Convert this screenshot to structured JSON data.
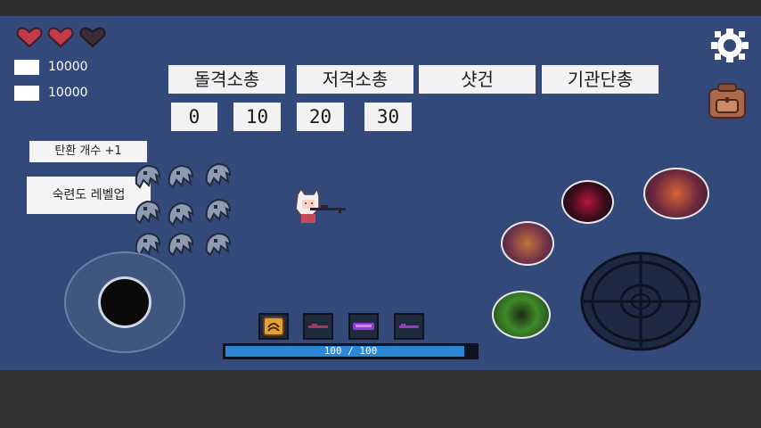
{
  "hud": {
    "hearts": [
      {
        "state": "full",
        "color": "#c23b4a"
      },
      {
        "state": "full",
        "color": "#c23b4a"
      },
      {
        "state": "empty",
        "color": "#3a2c38"
      }
    ],
    "resources": [
      {
        "value": "10000"
      },
      {
        "value": "10000"
      }
    ]
  },
  "weapons": {
    "tabs": [
      {
        "label": "돌격소총"
      },
      {
        "label": "저격소총"
      },
      {
        "label": "샷건"
      },
      {
        "label": "기관단총"
      }
    ],
    "levels": [
      "0",
      "10",
      "20",
      "30"
    ]
  },
  "actions": {
    "ammo_button": "탄환 개수 +1",
    "mastery_button": "숙련도 레벨업"
  },
  "player": {
    "hp_text": "100 / 100",
    "hp_current": 100,
    "hp_max": 100
  },
  "colors": {
    "background": "#33497a",
    "hp_bar": "#2c86d6",
    "button_bg": "#f2f2f2"
  },
  "icons": {
    "settings": "gear-icon",
    "inventory": "backpack-icon",
    "slot_1": "ammo-icon",
    "slot_2": "rifle-slot-icon",
    "slot_3": "purple-weapon-icon",
    "slot_4": "weapon-slot-icon"
  }
}
